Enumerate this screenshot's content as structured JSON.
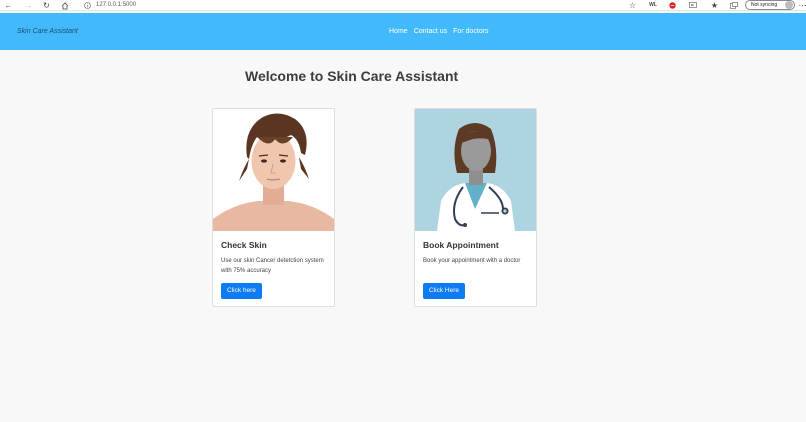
{
  "browser": {
    "url": "127.0.0.1:5000",
    "sync_label": "Not syncing"
  },
  "navbar": {
    "brand": "Skin Care Assistant",
    "links": [
      "Home",
      "Contact us",
      "For doctors"
    ],
    "bg_color": "#42b9fb"
  },
  "main": {
    "title": "Welcome to Skin Care Assistant",
    "cards": [
      {
        "image_icon": "man-portrait-illustration",
        "title": "Check Skin",
        "text": "Use our skin Cancer detetction system with 75% accuracy",
        "button": "Click here"
      },
      {
        "image_icon": "doctor-illustration",
        "title": "Book Appointment",
        "text": "Book your appointment with a doctor",
        "button": "Click Here"
      }
    ],
    "button_color": "#0d7bf2"
  }
}
